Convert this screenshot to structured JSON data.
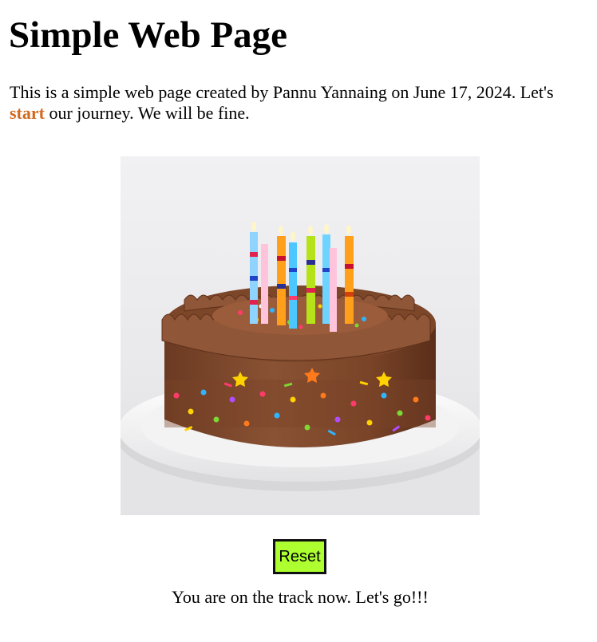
{
  "page": {
    "title": "Simple Web Page",
    "intro": {
      "text_before": "This is a simple web page created by Pannu Yannaing on June 17, 2024. Let's ",
      "highlight": "start",
      "text_after": " our journey. We will be fine."
    },
    "image": {
      "alt": "Chocolate birthday cake with rainbow sprinkles and striped candles"
    },
    "reset_button": {
      "label": "Reset"
    },
    "message": "You are on the track now. Let's go!!!"
  },
  "colors": {
    "accent_text": "#d2691e",
    "button_bg": "#adff2f"
  }
}
